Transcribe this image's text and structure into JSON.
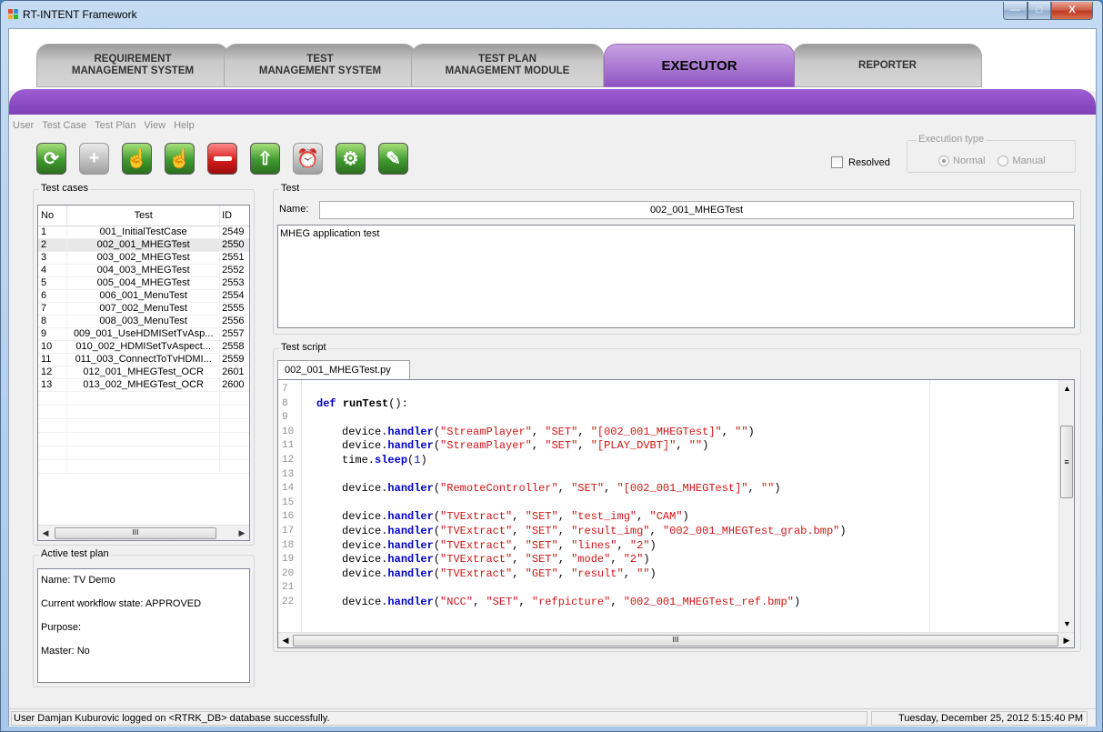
{
  "window": {
    "title": "RT-INTENT Framework",
    "min_glyph": "—",
    "max_glyph": "□",
    "close_glyph": "X"
  },
  "module_tabs": [
    {
      "line1": "REQUIREMENT",
      "line2": "MANAGEMENT SYSTEM"
    },
    {
      "line1": "TEST",
      "line2": "MANAGEMENT SYSTEM"
    },
    {
      "line1": "TEST PLAN",
      "line2": "MANAGEMENT MODULE"
    },
    {
      "line1": "EXECUTOR",
      "line2": ""
    },
    {
      "line1": "REPORTER",
      "line2": ""
    }
  ],
  "active_tab": "EXECUTOR",
  "menu": [
    "User",
    "Test Case",
    "Test Plan",
    "View",
    "Help"
  ],
  "toolbar_icons": [
    "refresh-icon",
    "add-icon",
    "run-icon",
    "run-all-icon",
    "remove-icon",
    "export-icon",
    "schedule-icon",
    "settings-icon",
    "edit-icon"
  ],
  "toolbar_glyphs": [
    "⟳",
    "+",
    "☝",
    "☝",
    "",
    "⇧",
    "⏰",
    "⚙",
    "✎"
  ],
  "resolved_label": "Resolved",
  "execution_type": {
    "title": "Execution type",
    "options": [
      "Normal",
      "Manual"
    ],
    "selected": "Normal"
  },
  "test_cases": {
    "title": "Test cases",
    "columns": [
      "No",
      "Test",
      "ID"
    ],
    "selected_index": 1,
    "rows": [
      {
        "no": "1",
        "test": "001_InitialTestCase",
        "id": "2549"
      },
      {
        "no": "2",
        "test": "002_001_MHEGTest",
        "id": "2550"
      },
      {
        "no": "3",
        "test": "003_002_MHEGTest",
        "id": "2551"
      },
      {
        "no": "4",
        "test": "004_003_MHEGTest",
        "id": "2552"
      },
      {
        "no": "5",
        "test": "005_004_MHEGTest",
        "id": "2553"
      },
      {
        "no": "6",
        "test": "006_001_MenuTest",
        "id": "2554"
      },
      {
        "no": "7",
        "test": "007_002_MenuTest",
        "id": "2555"
      },
      {
        "no": "8",
        "test": "008_003_MenuTest",
        "id": "2556"
      },
      {
        "no": "9",
        "test": "009_001_UseHDMISetTvAsp...",
        "id": "2557"
      },
      {
        "no": "10",
        "test": "010_002_HDMISetTvAspect...",
        "id": "2558"
      },
      {
        "no": "11",
        "test": "011_003_ConnectToTvHDMI...",
        "id": "2559"
      },
      {
        "no": "12",
        "test": "012_001_MHEGTest_OCR",
        "id": "2601"
      },
      {
        "no": "13",
        "test": "013_002_MHEGTest_OCR",
        "id": "2600"
      }
    ],
    "scroll_grip": "III"
  },
  "active_plan": {
    "title": "Active test plan",
    "lines": [
      "Name: TV Demo",
      "Current workflow state: APPROVED",
      "Purpose:",
      "Master: No"
    ]
  },
  "test": {
    "title": "Test",
    "name_label": "Name:",
    "name_value": "002_001_MHEGTest",
    "description": "MHEG application test"
  },
  "script": {
    "title": "Test script",
    "tab": "002_001_MHEGTest.py",
    "lines": [
      {
        "n": "7",
        "code": ""
      },
      {
        "n": "8",
        "code": "def runTest():"
      },
      {
        "n": "9",
        "code": ""
      },
      {
        "n": "10",
        "code": "device.handler(\"StreamPlayer\", \"SET\", \"[002_001_MHEGTest]\", \"\")"
      },
      {
        "n": "11",
        "code": "device.handler(\"StreamPlayer\", \"SET\", \"[PLAY_DVBT]\", \"\")"
      },
      {
        "n": "12",
        "code": "time.sleep(1)"
      },
      {
        "n": "13",
        "code": ""
      },
      {
        "n": "14",
        "code": "device.handler(\"RemoteController\", \"SET\", \"[002_001_MHEGTest]\", \"\")"
      },
      {
        "n": "15",
        "code": ""
      },
      {
        "n": "16",
        "code": "device.handler(\"TVExtract\", \"SET\", \"test_img\", \"CAM\")"
      },
      {
        "n": "17",
        "code": "device.handler(\"TVExtract\", \"SET\", \"result_img\", \"002_001_MHEGTest_grab.bmp\")"
      },
      {
        "n": "18",
        "code": "device.handler(\"TVExtract\", \"SET\", \"lines\", \"2\")"
      },
      {
        "n": "19",
        "code": "device.handler(\"TVExtract\", \"SET\", \"mode\", \"2\")"
      },
      {
        "n": "20",
        "code": "device.handler(\"TVExtract\", \"GET\", \"result\", \"\")"
      },
      {
        "n": "21",
        "code": ""
      },
      {
        "n": "22",
        "code": "device.handler(\"NCC\", \"SET\", \"refpicture\", \"002_001_MHEGTest_ref.bmp\")"
      }
    ],
    "scroll_grip": "III",
    "vscroll_grip": "≡"
  },
  "status": {
    "message": "User Damjan Kuburovic logged on <RTRK_DB> database successfully.",
    "datetime": "Tuesday, December 25, 2012   5:15:40 PM"
  },
  "colors": {
    "accent_purple": "#8f54c0",
    "string_red": "#d01515",
    "keyword_blue": "#0000c8"
  }
}
